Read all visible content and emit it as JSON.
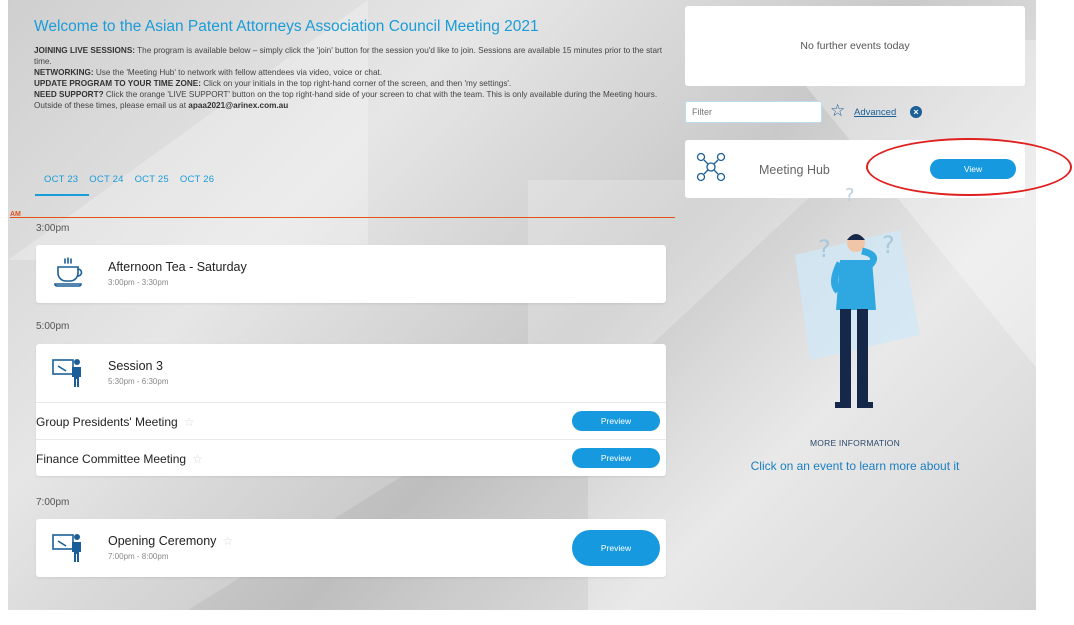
{
  "intro": {
    "title": "Welcome to the Asian Patent Attorneys Association Council Meeting 2021",
    "lines": [
      {
        "label": "JOINING LIVE SESSIONS:",
        "text": " The program is available below – simply click the 'join' button for the session you'd like to join. Sessions are available 15 minutes prior to the start time."
      },
      {
        "label": "NETWORKING:",
        "text": " Use the 'Meeting Hub' to network with fellow attendees via video, voice or chat."
      },
      {
        "label": "UPDATE PROGRAM TO YOUR TIME ZONE:",
        "text": " Click on your initials in the top right-hand corner of the screen, and then 'my settings'."
      },
      {
        "label": "NEED SUPPORT?",
        "text": " Click the orange 'LIVE SUPPORT' button on the top right-hand side of your screen to chat with the team. This is only available during the Meeting hours. Outside of these times, please email us at ",
        "email": "apaa2021@arinex.com.au"
      }
    ]
  },
  "tabs": [
    {
      "label": "OCT 23",
      "active": true
    },
    {
      "label": "OCT 24",
      "active": false
    },
    {
      "label": "OCT 25",
      "active": false
    },
    {
      "label": "OCT 26",
      "active": false
    }
  ],
  "now_label": "AM",
  "schedule": {
    "slot1": {
      "time": "3:00pm",
      "event": {
        "title": "Afternoon Tea - Saturday",
        "time": "3:00pm - 3:30pm",
        "icon": "tea-cup-icon"
      }
    },
    "slot2": {
      "time": "5:00pm",
      "event": {
        "title": "Session 3",
        "time": "5:30pm - 6:30pm",
        "icon": "presenter-icon"
      },
      "sub_sessions": [
        {
          "title": "Group Presidents' Meeting",
          "button": "Preview"
        },
        {
          "title": "Finance Committee Meeting",
          "button": "Preview"
        }
      ]
    },
    "slot3": {
      "time": "7:00pm",
      "event": {
        "title": "Opening Ceremony",
        "time": "7:00pm - 8:00pm",
        "icon": "presenter-icon",
        "button": "Preview"
      }
    }
  },
  "sidebar": {
    "no_events": "No further events today",
    "filter_placeholder": "Filter",
    "advanced_label": "Advanced",
    "hub": {
      "label": "Meeting Hub",
      "button": "View"
    },
    "more_info_title": "MORE INFORMATION",
    "more_info_text": "Click on an event to learn more about it"
  },
  "colors": {
    "accent": "#1799df",
    "title_blue": "#1a9cd8",
    "now_line": "#e0521c",
    "annotation": "#e02020"
  }
}
